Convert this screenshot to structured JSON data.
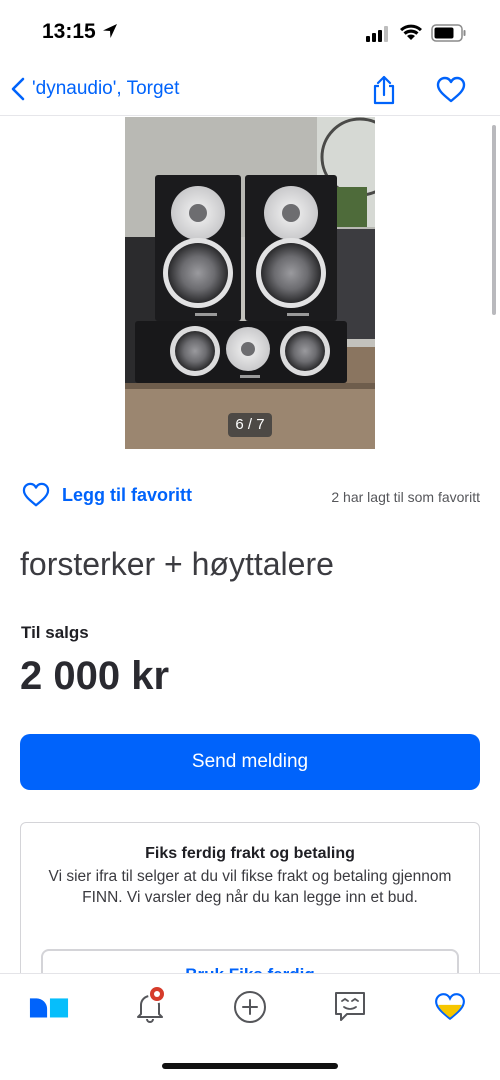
{
  "status_bar": {
    "time": "13:15"
  },
  "nav": {
    "back_label": "'dynaudio', Torget"
  },
  "gallery": {
    "counter": "6 / 7"
  },
  "favorite": {
    "link_label": "Legg til favoritt",
    "count_text": "2 har lagt til som favoritt"
  },
  "ad": {
    "title": "forsterker + høyttalere",
    "sale_type": "Til salgs",
    "price": "2 000 kr"
  },
  "send_button": {
    "label": "Send melding"
  },
  "info_box": {
    "title": "Fiks ferdig frakt og betaling",
    "text": "Vi sier ifra til selger at du vil fikse frakt og betaling gjennom FINN. Vi varsler deg når du kan legge inn et bud.",
    "button_label": "Bruk Fiks ferdig"
  },
  "colors": {
    "accent": "#0063fb",
    "notification": "#d63b2a",
    "favorite_tab": "#f6c600"
  },
  "tab_bar": {
    "tabs": [
      {
        "icon": "home-icon",
        "active": true
      },
      {
        "icon": "bell-icon",
        "has_notification": true
      },
      {
        "icon": "plus-circle-icon"
      },
      {
        "icon": "chat-icon"
      },
      {
        "icon": "heart-icon"
      }
    ]
  }
}
